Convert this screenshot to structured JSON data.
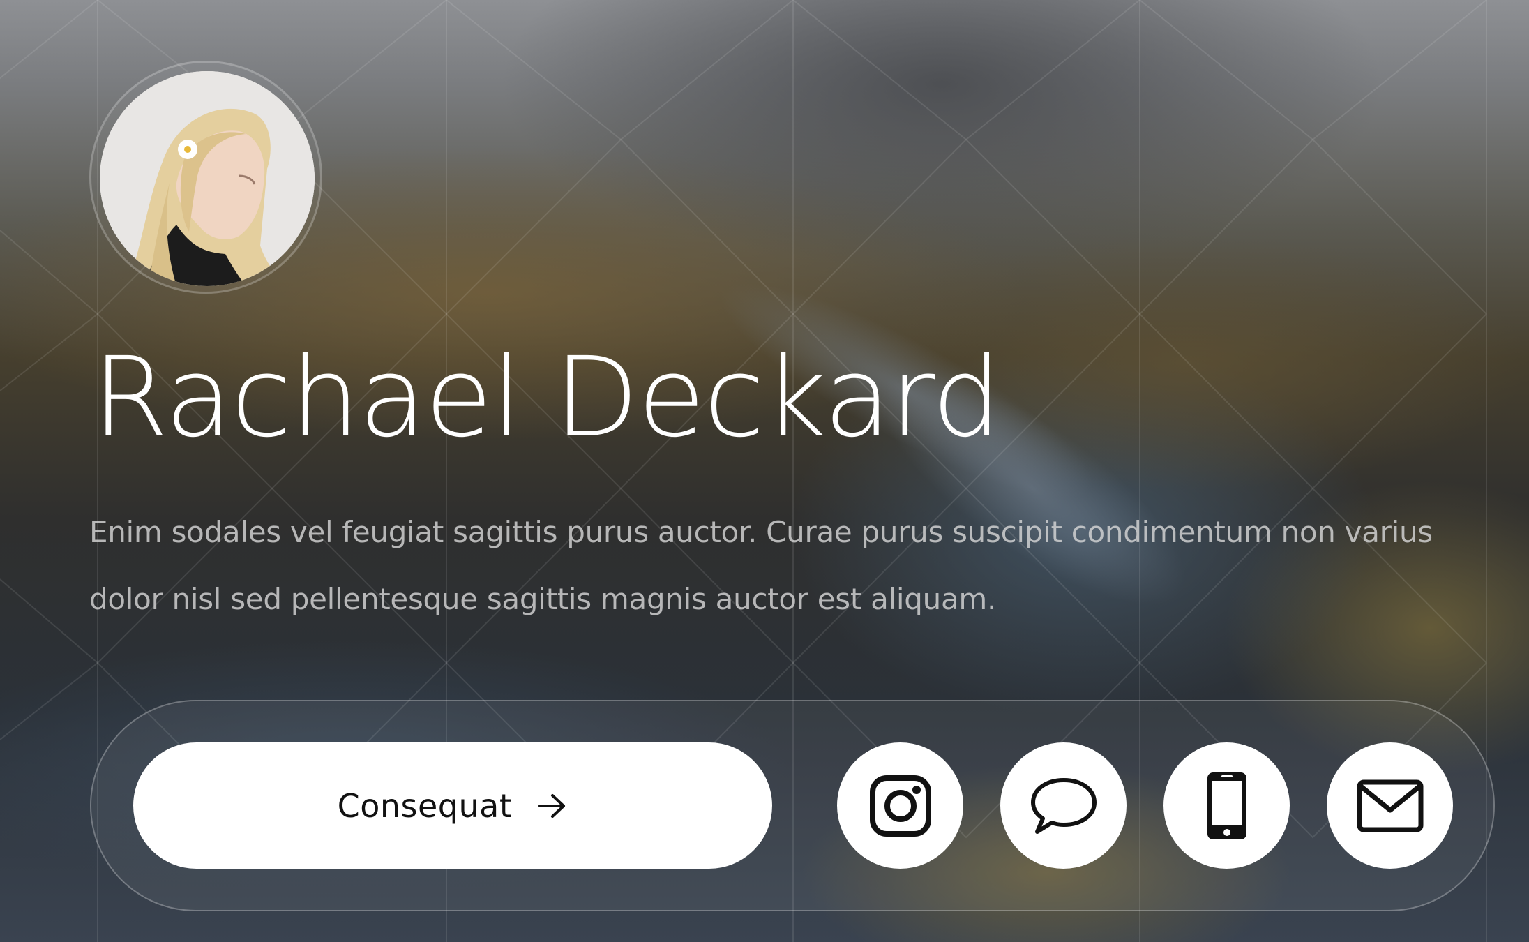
{
  "profile": {
    "name": "Rachael Deckard",
    "bio": "Enim sodales vel feugiat sagittis purus auctor. Curae purus suscipit condimentum non varius dolor nisl sed pellentesque sagittis magnis auctor est aliquam.",
    "avatar_icon": "profile-photo"
  },
  "actions": {
    "primary_label": "Consequat",
    "primary_icon": "arrow-right-icon",
    "social": [
      {
        "icon": "instagram-icon"
      },
      {
        "icon": "chat-bubble-icon"
      },
      {
        "icon": "mobile-phone-icon"
      },
      {
        "icon": "envelope-icon"
      }
    ]
  },
  "colors": {
    "button_bg": "#ffffff",
    "text_primary": "#ffffff",
    "icon": "#111111"
  }
}
